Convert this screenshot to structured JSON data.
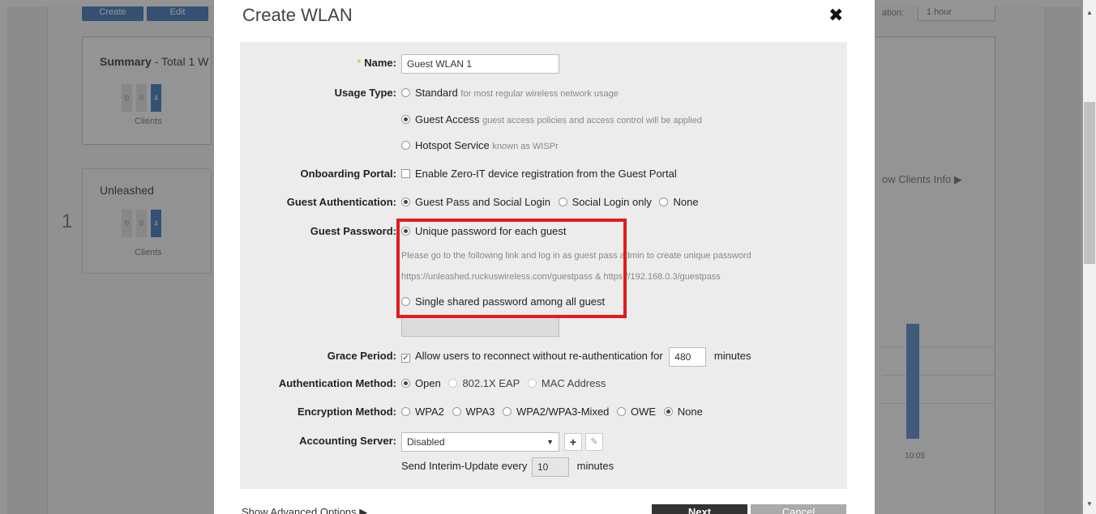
{
  "background": {
    "buttons": [
      "Create",
      "Edit"
    ],
    "summary": {
      "title": "Summary",
      "subtitle": "- Total 1 W",
      "stats": [
        "0",
        "0",
        "4"
      ],
      "label": "Clients"
    },
    "unleashed": {
      "title": "Unleashed",
      "stats": [
        "0",
        "0",
        "4"
      ],
      "label": "Clients",
      "index": "1"
    },
    "top_label": "ation:",
    "top_select": "1 hour",
    "show_clients": "ow Clients Info ▶",
    "chart_tick": "10:05"
  },
  "dialog": {
    "title": "Create WLAN",
    "close_icon": "✖",
    "name": {
      "label": "Name:",
      "required": "*",
      "value": "Guest WLAN 1"
    },
    "usage_type": {
      "label": "Usage Type:",
      "options": [
        {
          "label": "Standard",
          "hint": "for most regular wireless network usage",
          "selected": false
        },
        {
          "label": "Guest Access",
          "hint": "guest access policies and access control will be applied",
          "selected": true
        },
        {
          "label": "Hotspot Service",
          "hint": "known as WISPr",
          "selected": false
        }
      ]
    },
    "onboarding": {
      "label": "Onboarding Portal:",
      "option": "Enable Zero-IT device registration from the Guest Portal",
      "checked": false
    },
    "guest_auth": {
      "label": "Guest Authentication:",
      "options": [
        "Guest Pass and Social Login",
        "Social Login only",
        "None"
      ],
      "selected": 0
    },
    "guest_password": {
      "label": "Guest Password:",
      "option_unique": "Unique password for each guest",
      "info_1": "Please go to the following link and log in as guest pass admin to create unique password",
      "info_2": "https://unleashed.ruckuswireless.com/guestpass & https://192.168.0.3/guestpass",
      "option_shared": "Single shared password among all guest",
      "selected": "unique"
    },
    "grace_period": {
      "label": "Grace Period:",
      "text": "Allow users to reconnect without re-authentication for",
      "value": "480",
      "unit": "minutes",
      "checked": true
    },
    "auth_method": {
      "label": "Authentication Method:",
      "options": [
        "Open",
        "802.1X EAP",
        "MAC Address"
      ],
      "selected": 0
    },
    "encryption": {
      "label": "Encryption Method:",
      "options": [
        "WPA2",
        "WPA3",
        "WPA2/WPA3-Mixed",
        "OWE",
        "None"
      ],
      "selected": 4
    },
    "accounting": {
      "label": "Accounting Server:",
      "value": "Disabled",
      "add_label": "+",
      "edit_label": "✎"
    },
    "interim": {
      "text": "Send Interim-Update every",
      "value": "10",
      "unit": "minutes"
    },
    "advanced": "Show Advanced Options ▶",
    "next_label": "Next",
    "cancel_label": "Cancel",
    "highlight_color": "#e21c1c"
  }
}
